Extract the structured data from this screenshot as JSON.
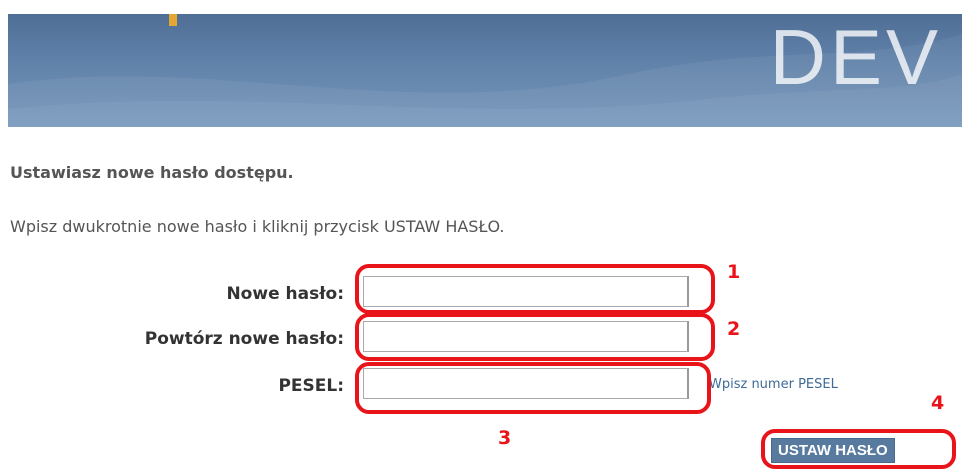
{
  "banner": {
    "env_label": "DEV",
    "colors": {
      "top": "#4f6e96",
      "bottom": "#7495ba",
      "accent": "#e3a632"
    }
  },
  "content": {
    "heading": "Ustawiasz nowe hasło dostępu.",
    "instruction": "Wpisz dwukrotnie nowe hasło i kliknij przycisk USTAW HASŁO."
  },
  "form": {
    "new_password": {
      "label": "Nowe hasło:",
      "value": ""
    },
    "repeat_password": {
      "label": "Powtórz nowe hasło:",
      "value": ""
    },
    "pesel": {
      "label": "PESEL:",
      "value": "",
      "hint": "Wpisz numer PESEL"
    },
    "submit_label": "USTAW HASŁO"
  },
  "annotations": {
    "color": "#e8141a",
    "markers": [
      "1",
      "2",
      "3",
      "4"
    ]
  }
}
